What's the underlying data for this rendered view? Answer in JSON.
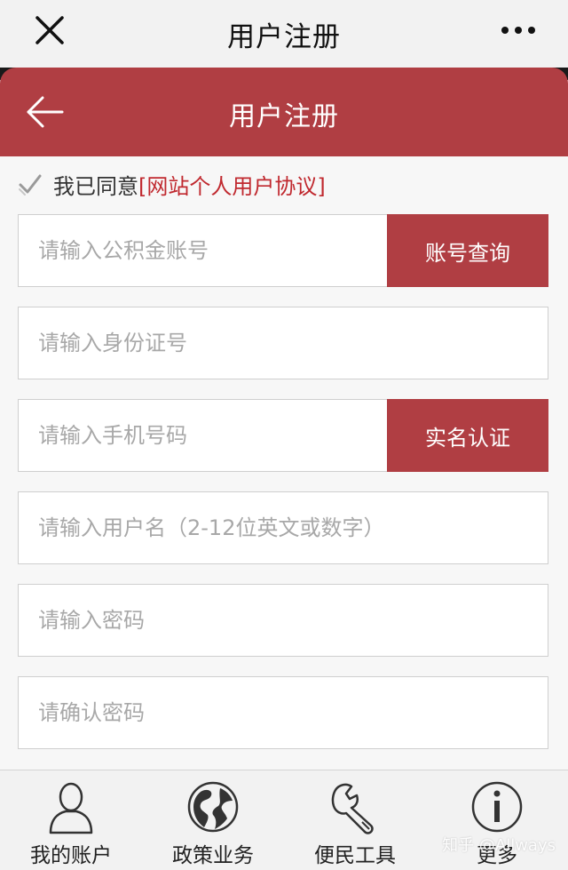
{
  "window": {
    "title": "用户注册"
  },
  "header": {
    "title": "用户注册",
    "accent_color": "#b03e43"
  },
  "agreement": {
    "text": "我已同意",
    "link_label": "[网站个人用户协议]",
    "checked": true
  },
  "form": {
    "account": {
      "placeholder": "请输入公积金账号",
      "button_label": "账号查询"
    },
    "id_number": {
      "placeholder": "请输入身份证号"
    },
    "phone": {
      "placeholder": "请输入手机号码",
      "button_label": "实名认证"
    },
    "username": {
      "placeholder": "请输入用户名（2-12位英文或数字）"
    },
    "password": {
      "placeholder": "请输入密码"
    },
    "confirm_password": {
      "placeholder": "请确认密码"
    }
  },
  "tabbar": {
    "items": [
      {
        "label": "我的账户",
        "icon": "user-icon"
      },
      {
        "label": "政策业务",
        "icon": "globe-icon"
      },
      {
        "label": "便民工具",
        "icon": "wrench-icon"
      },
      {
        "label": "更多",
        "icon": "info-icon"
      }
    ]
  },
  "watermark": "知乎 @Allways"
}
